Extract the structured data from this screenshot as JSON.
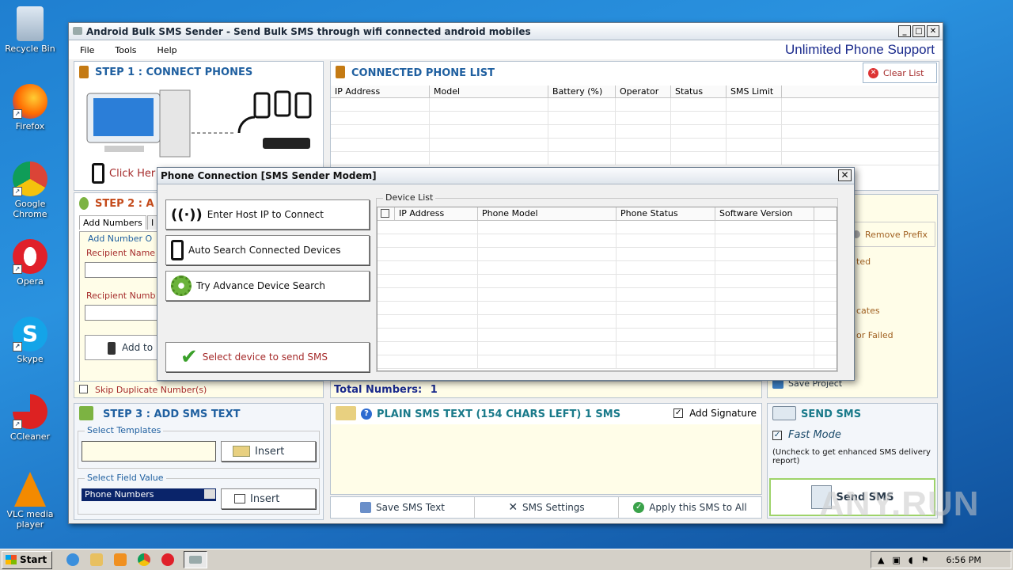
{
  "desktop": {
    "icons": [
      {
        "label": "Recycle Bin"
      },
      {
        "label": "Firefox"
      },
      {
        "label": "Google Chrome"
      },
      {
        "label": "Opera"
      },
      {
        "label": "Skype"
      },
      {
        "label": "CCleaner"
      },
      {
        "label": "VLC media player"
      }
    ]
  },
  "window": {
    "title": "Android Bulk SMS Sender - Send Bulk SMS through wifi connected android mobiles",
    "menu": [
      "File",
      "Tools",
      "Help"
    ],
    "support_text": "Unlimited Phone Support",
    "step1": {
      "title": "STEP 1 : CONNECT PHONES",
      "click_here": "Click Her"
    },
    "step2": {
      "title": "STEP 2 : A",
      "tab_add_numbers": "Add Numbers",
      "tab_other": "I",
      "group_label": "Add Number O",
      "recipient_name": "Recipient Name",
      "recipient_number": "Recipient Numb",
      "add_to": "Add to",
      "skip_duplicate": "Skip Duplicate Number(s)"
    },
    "connected": {
      "title": "CONNECTED PHONE LIST",
      "clear_list": "Clear List",
      "columns": [
        "IP Address",
        "Model",
        "Battery (%)",
        "Operator",
        "Status",
        "SMS Limit"
      ]
    },
    "right_options": {
      "remove_prefix": "Remove Prefix",
      "item1": "ted",
      "item2": "cates",
      "item3": "or Failed",
      "save_project": "Save Project"
    },
    "total_numbers": {
      "label": "Total Numbers:",
      "value": "1"
    },
    "step3": {
      "title": "STEP 3 : ADD SMS TEXT",
      "select_templates": "Select Templates",
      "insert1": "Insert",
      "select_field": "Select Field Value",
      "field_value": "Phone Numbers",
      "insert2": "Insert"
    },
    "sms_text": {
      "title": "PLAIN SMS TEXT (154 CHARS LEFT) 1 SMS",
      "add_signature": "Add Signature",
      "save": "Save SMS Text",
      "settings": "SMS Settings",
      "apply": "Apply this SMS to All"
    },
    "send": {
      "title": "SEND SMS",
      "fast_mode": "Fast Mode",
      "note": "(Uncheck to get enhanced SMS delivery report)",
      "button": "Send SMS"
    }
  },
  "dialog": {
    "title": "Phone Connection [SMS Sender Modem]",
    "buttons": {
      "host_ip": "Enter Host IP to Connect",
      "auto_search": "Auto Search Connected Devices",
      "advance": "Try Advance Device Search",
      "select_device": "Select device to send SMS"
    },
    "device_list": {
      "label": "Device List",
      "columns": [
        "IP Address",
        "Phone Model",
        "Phone Status",
        "Software Version"
      ]
    }
  },
  "taskbar": {
    "start": "Start",
    "time": "6:56 PM"
  },
  "watermark": "ANY.RUN"
}
